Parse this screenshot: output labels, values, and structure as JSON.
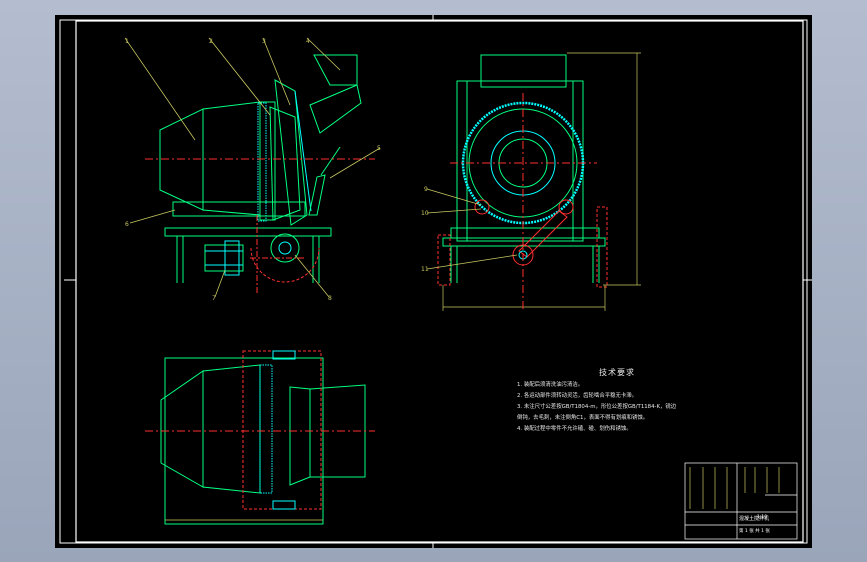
{
  "drawing": {
    "part_labels": [
      "1",
      "2",
      "3",
      "4",
      "5",
      "6",
      "7",
      "8",
      "9",
      "10",
      "11"
    ],
    "technical_requirements": {
      "title": "技术要求",
      "items": [
        "1. 装配后须清洗油污清洁。",
        "2. 各运动部件须转动灵活，齿轮啮合平稳无卡滞。",
        "3. 未注尺寸公差按GB/T1804-m，形位公差按GB/T1184-K，锐边",
        "倒钝，去毛刺，未注倒角C1，表面不得有划痕和锈蚀。",
        "4. 装配过程中零件不允许磕、碰、划伤和锈蚀。"
      ]
    },
    "title_block": {
      "scale": "1:10",
      "drawing_name": "混凝土搅拌机",
      "sheet_info": "第 1 张 共 1 张"
    },
    "colors": {
      "sheet": "#000000",
      "frame": "#ffffff",
      "outline": "#00ff80",
      "detail": "#00ffff",
      "hidden": "#ff3030",
      "leader": "#c8c860"
    }
  }
}
